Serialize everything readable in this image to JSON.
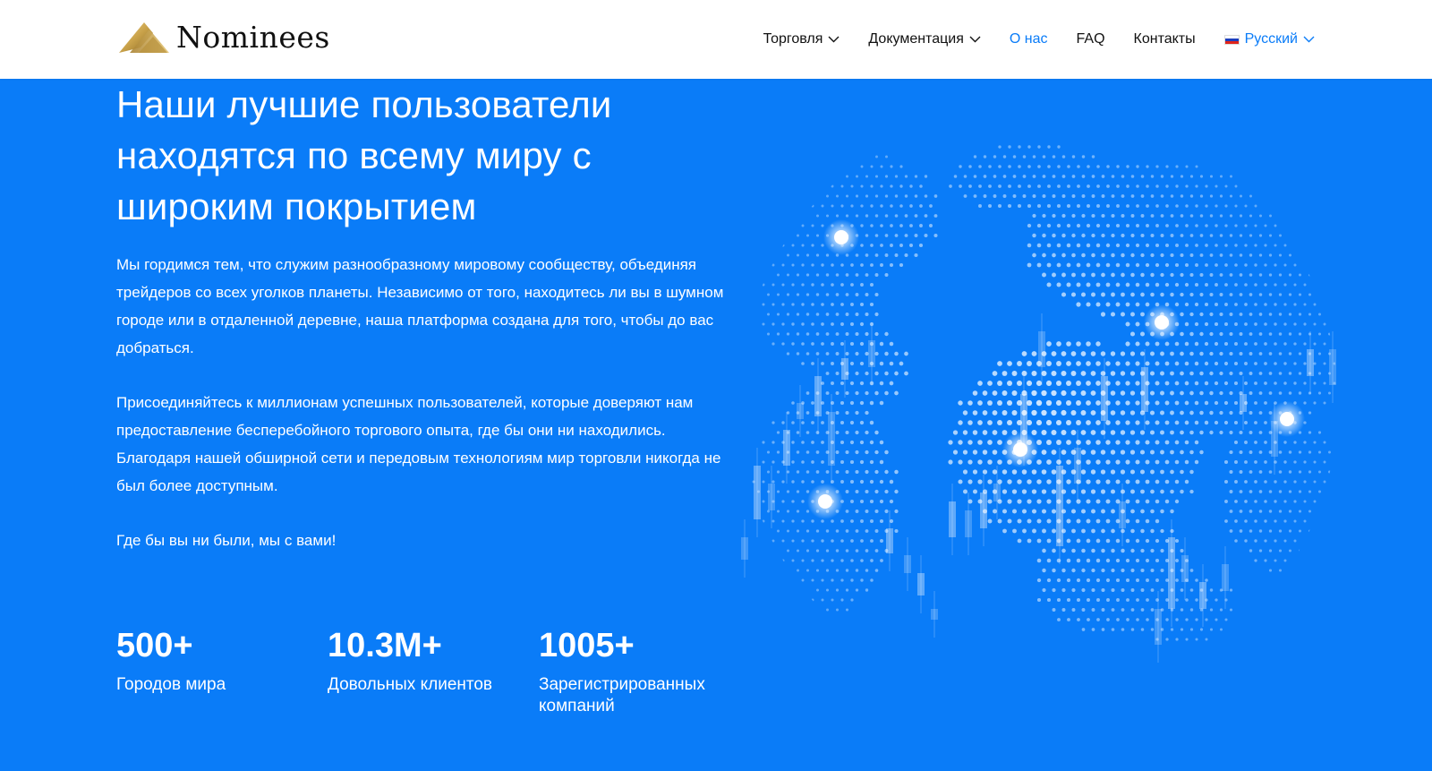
{
  "brand": {
    "name": "Nominees"
  },
  "nav": {
    "items": [
      {
        "label": "Торговля",
        "has_dropdown": true,
        "active": false
      },
      {
        "label": "Документация",
        "has_dropdown": true,
        "active": false
      },
      {
        "label": "О нас",
        "has_dropdown": false,
        "active": true
      },
      {
        "label": "FAQ",
        "has_dropdown": false,
        "active": false
      },
      {
        "label": "Контакты",
        "has_dropdown": false,
        "active": false
      }
    ],
    "language": {
      "label": "Русский",
      "flag": "ru-flag-icon"
    }
  },
  "hero": {
    "title": "Наши лучшие пользователи находятся по всему миру с широким покрытием",
    "paragraphs": [
      "Мы гордимся тем, что служим разнообразному мировому сообществу, объединяя трейдеров со всех уголков планеты. Независимо от того, находитесь ли вы в шумном городе или в отдаленной деревне, наша платформа создана для того, чтобы до вас добраться.",
      "Присоединяйтесь к миллионам успешных пользователей, которые доверяют нам предоставление бесперебойного торгового опыта, где бы они ни находились. Благодаря нашей обширной сети и передовым технологиям мир торговли никогда не был более доступным.",
      "Где бы вы ни были, мы с вами!"
    ]
  },
  "stats": [
    {
      "value": "500+",
      "label": "Городов мира"
    },
    {
      "value": "10.3M+",
      "label": "Довольных клиентов"
    },
    {
      "value": "1005+",
      "label": "Зарегистрированных компаний"
    }
  ],
  "colors": {
    "hero_bg": "#0a7cf8",
    "nav_active": "#0a7cf8",
    "logo_gold": "#c9a24a"
  },
  "icons": {
    "logo": "nominees-logo-icon",
    "dropdown": "chevron-down-icon",
    "globe": "world-globe-illustration"
  }
}
